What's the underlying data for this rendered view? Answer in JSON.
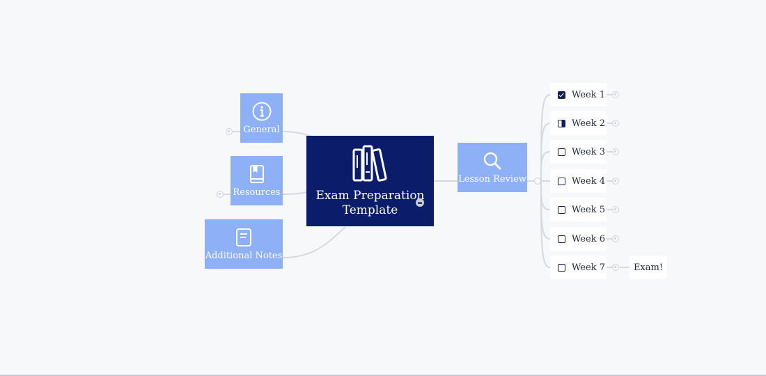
{
  "mindmap": {
    "root": {
      "label": "Exam Preparation Template",
      "icon": "books-icon",
      "color": "#0b1c6a"
    },
    "left_branches": [
      {
        "label": "General",
        "icon": "info-icon"
      },
      {
        "label": "Resources",
        "icon": "book-icon"
      },
      {
        "label": "Additional Notes",
        "icon": "notepad-icon"
      }
    ],
    "right_branch": {
      "label": "Lesson Review",
      "icon": "search-icon",
      "children": [
        {
          "label": "Week 1",
          "status": "checked"
        },
        {
          "label": "Week 2",
          "status": "partial"
        },
        {
          "label": "Week 3",
          "status": "unchecked"
        },
        {
          "label": "Week 4",
          "status": "unchecked"
        },
        {
          "label": "Week 5",
          "status": "unchecked"
        },
        {
          "label": "Week 6",
          "status": "unchecked"
        },
        {
          "label": "Week 7",
          "status": "unchecked",
          "child": "Exam!"
        }
      ]
    },
    "colors": {
      "branch_node": "#8db0f7",
      "root_node": "#0b1c6a",
      "connector": "#d6d9de",
      "background": "#f7f8fa"
    }
  }
}
